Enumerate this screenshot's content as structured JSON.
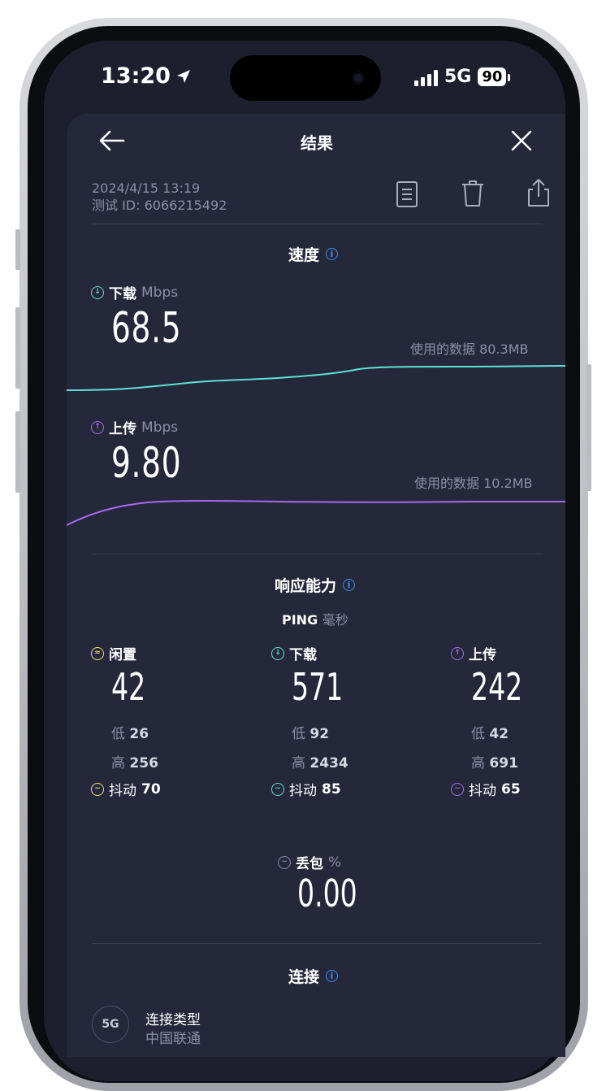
{
  "status_bar": {
    "time": "13:20",
    "network": "5G",
    "battery": "90"
  },
  "header": {
    "title": "结果"
  },
  "meta": {
    "datetime": "2024/4/15 13:19",
    "test_id": "测试 ID: 6066215492"
  },
  "speed": {
    "title": "速度",
    "download": {
      "label": "下载",
      "unit": "Mbps",
      "value": "68.5",
      "data_used": "使用的数据 80.3MB",
      "color": "#5ee0d9"
    },
    "upload": {
      "label": "上传",
      "unit": "Mbps",
      "value": "9.80",
      "data_used": "使用的数据 10.2MB",
      "color": "#a56bf2"
    }
  },
  "responsiveness": {
    "title": "响应能力",
    "ping_label": "PING",
    "ping_unit": "毫秒",
    "columns": [
      {
        "label": "闲置",
        "value": "42",
        "low_label": "低",
        "low": "26",
        "high_label": "高",
        "high": "256",
        "jitter_label": "抖动",
        "jitter": "70",
        "color": "#f3e06a"
      },
      {
        "label": "下载",
        "value": "571",
        "low_label": "低",
        "low": "92",
        "high_label": "高",
        "high": "2434",
        "jitter_label": "抖动",
        "jitter": "85",
        "color": "#5ee0d9"
      },
      {
        "label": "上传",
        "value": "242",
        "low_label": "低",
        "low": "42",
        "high_label": "高",
        "high": "691",
        "jitter_label": "抖动",
        "jitter": "65",
        "color": "#a56bf2"
      }
    ],
    "packet_loss": {
      "label": "丢包",
      "unit": "%",
      "value": "0.00"
    }
  },
  "connection": {
    "title": "连接",
    "type_badge": "5G",
    "type_label": "连接类型",
    "carrier": "中国联通"
  }
}
